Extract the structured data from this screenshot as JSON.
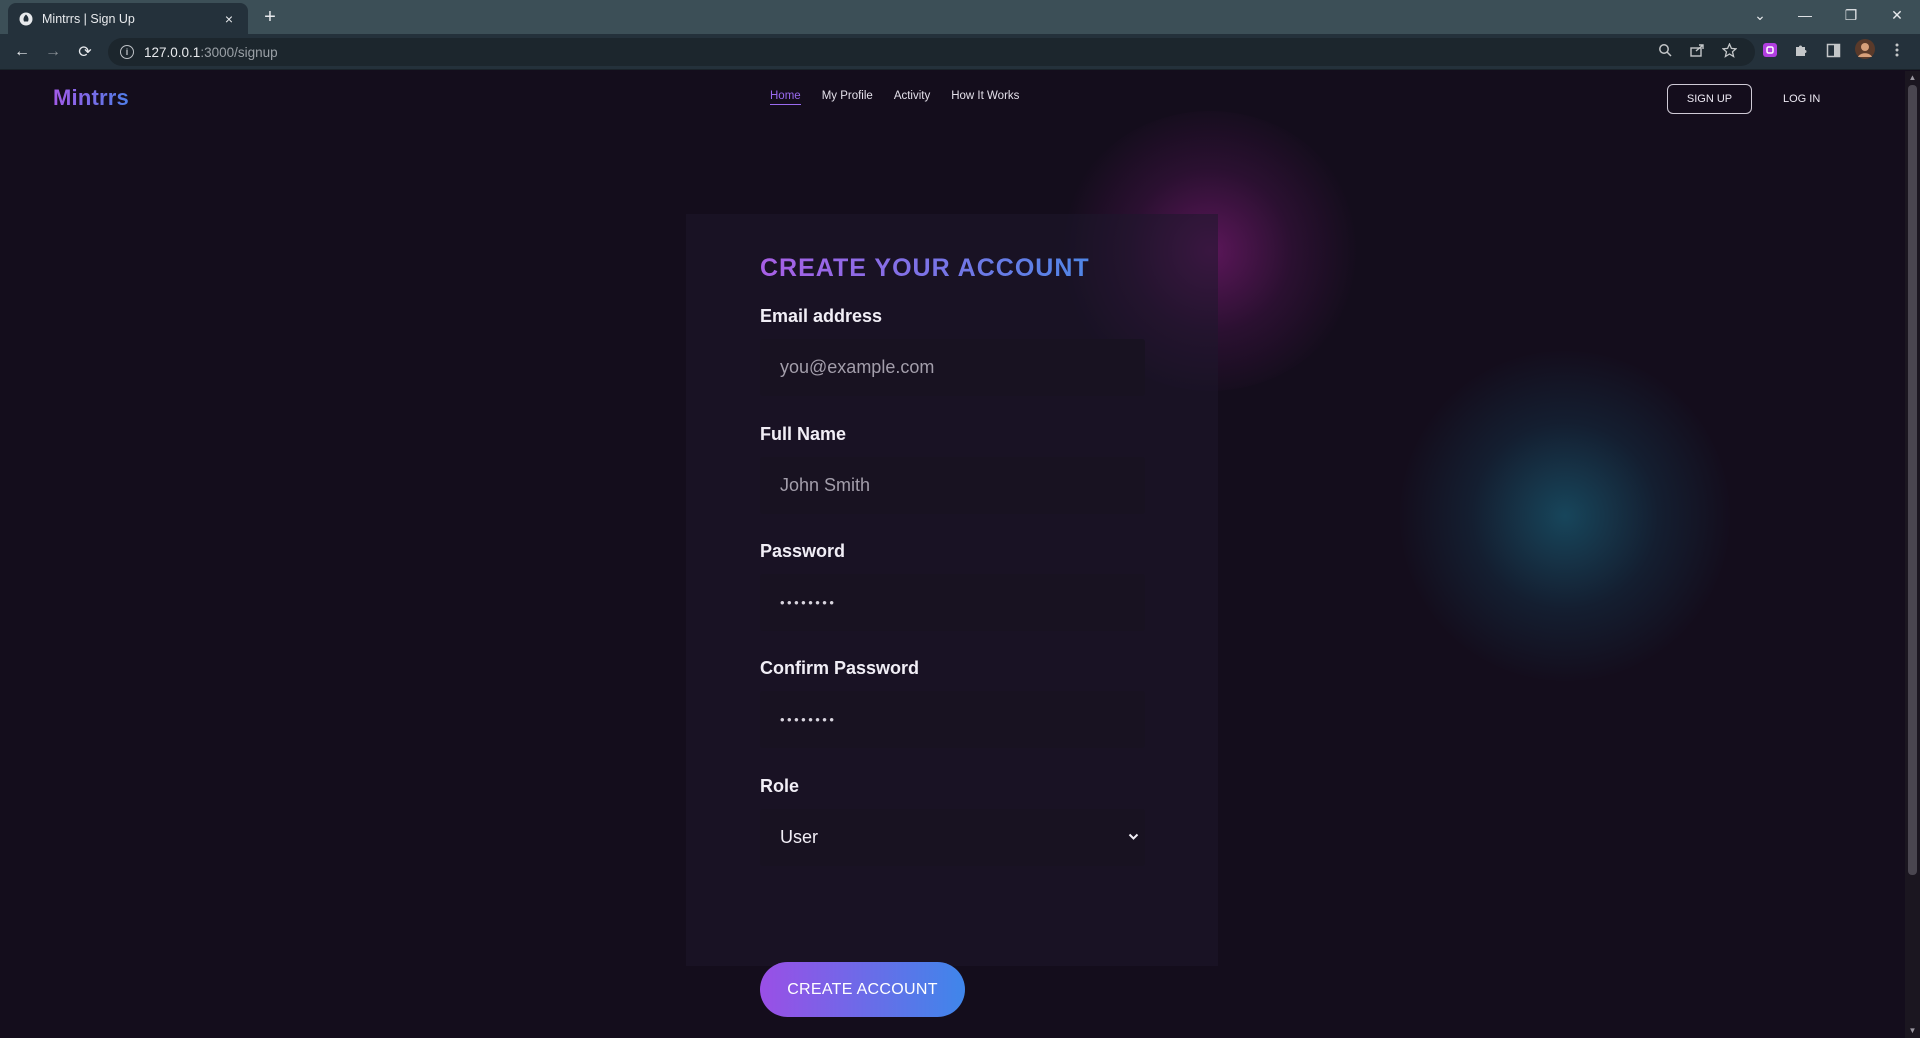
{
  "browser": {
    "tab_title": "Mintrrs | Sign Up",
    "close_glyph": "×",
    "new_tab_glyph": "+",
    "url_host": "127.0.0.1",
    "url_path": ":3000/signup",
    "window_controls": {
      "tablist": "⌄",
      "minimize": "—",
      "restore": "❐",
      "close": "✕"
    },
    "nav": {
      "back": "←",
      "forward": "→",
      "reload": "⟳"
    }
  },
  "site": {
    "logo": "Mintrrs",
    "menu": [
      {
        "label": "Home",
        "active": true
      },
      {
        "label": "My Profile",
        "active": false
      },
      {
        "label": "Activity",
        "active": false
      },
      {
        "label": "How It Works",
        "active": false
      }
    ],
    "signup_label": "SIGN UP",
    "login_label": "LOG IN"
  },
  "form": {
    "title": "CREATE YOUR ACCOUNT",
    "email": {
      "label": "Email address",
      "placeholder": "you@example.com"
    },
    "full_name": {
      "label": "Full Name",
      "placeholder": "John Smith"
    },
    "password": {
      "label": "Password",
      "value": "••••••••"
    },
    "confirm_password": {
      "label": "Confirm Password",
      "value": "••••••••"
    },
    "role": {
      "label": "Role",
      "value": "User"
    },
    "submit_label": "CREATE ACCOUNT"
  },
  "colors": {
    "page_bg": "#140d1c",
    "card_bg": "#1e182c",
    "accent_purple": "#9a4fe6",
    "accent_blue": "#3f86ea",
    "glow_pink": "#961e8c",
    "glow_teal": "#19647d"
  },
  "icons": [
    "incognito-favicon-icon",
    "info-icon",
    "zoom-icon",
    "share-icon",
    "star-icon",
    "extension-purple-icon",
    "puzzle-icon",
    "sidepanel-icon",
    "profile-avatar",
    "kebab-menu-icon",
    "chevron-down-icon"
  ]
}
